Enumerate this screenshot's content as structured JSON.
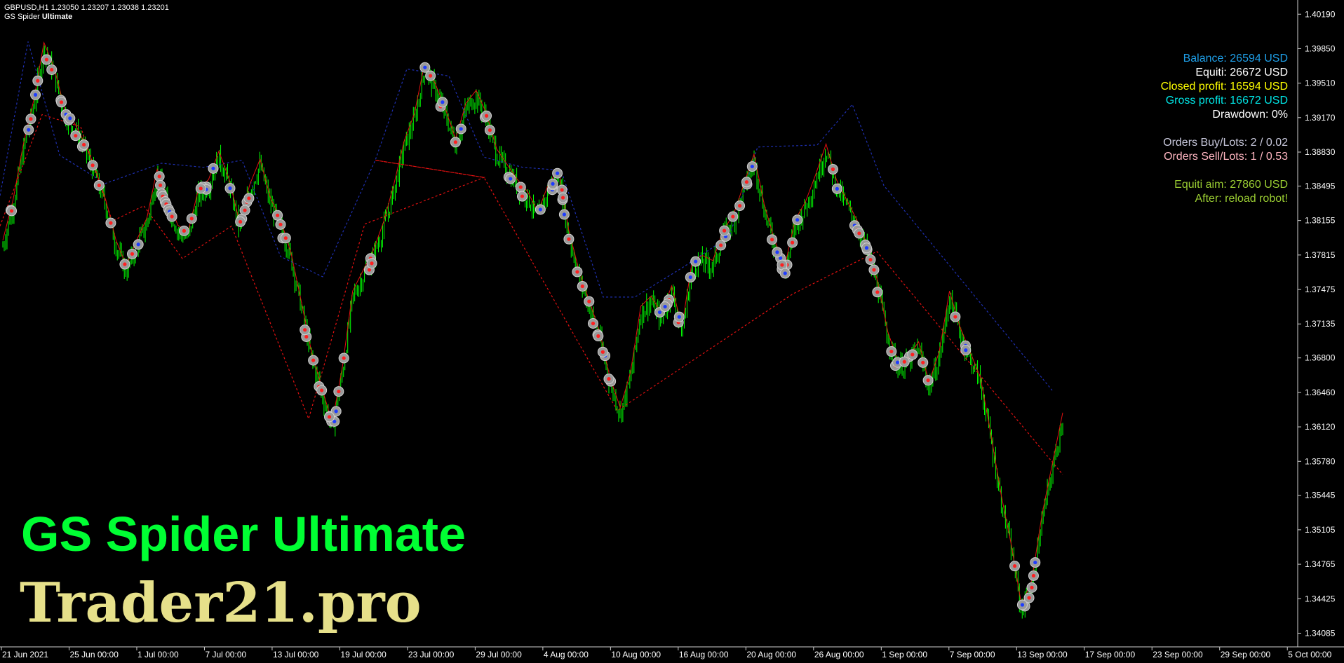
{
  "header": {
    "symbol_line": "GBPUSD,H1  1.23050 1.23207 1.23038 1.23201",
    "indicator_prefix": "GS Spider",
    "indicator_suffix": "Ultimate"
  },
  "info": {
    "balance": "Balance: 26594 USD",
    "equity": "Equiti: 26672 USD",
    "closed_profit": "Closed profit: 16594 USD",
    "gross_profit": "Gross profit: 16672 USD",
    "drawdown": "Drawdown: 0%",
    "orders_buy": "Orders Buy/Lots: 2 / 0.02",
    "orders_sell": "Orders Sell/Lots: 1 / 0.53",
    "equity_aim": "Equiti aim: 27860 USD",
    "after": "After: reload robot!"
  },
  "overlay": {
    "title": "GS Spider Ultimate",
    "site": "Trader21.pro"
  },
  "colors": {
    "background": "#000000",
    "candles": "#00ff00",
    "balance": "#1e9fe8",
    "equity": "#ffffff",
    "closed_profit": "#ffff00",
    "gross_profit": "#00e5e5",
    "orders_buy": "#c8c8dc",
    "orders_sell": "#ffb6c1",
    "equity_aim": "#9acd32",
    "title": "#00ff33",
    "site": "#e6e08a",
    "buy_line": "#1e2fb0",
    "sell_line": "#e01010"
  },
  "chart_data": {
    "type": "line",
    "symbol": "GBPUSD",
    "timeframe": "H1",
    "x_ticks": [
      "21 Jun 2021",
      "25 Jun 00:00",
      "1 Jul 00:00",
      "7 Jul 00:00",
      "13 Jul 00:00",
      "19 Jul 00:00",
      "23 Jul 00:00",
      "29 Jul 00:00",
      "4 Aug 00:00",
      "10 Aug 00:00",
      "16 Aug 00:00",
      "20 Aug 00:00",
      "26 Aug 00:00",
      "1 Sep 00:00",
      "7 Sep 00:00",
      "13 Sep 00:00",
      "17 Sep 00:00",
      "23 Sep 00:00",
      "29 Sep 00:00",
      "5 Oct 00:00"
    ],
    "y_ticks": [
      "1.40190",
      "1.39850",
      "1.39510",
      "1.39170",
      "1.38830",
      "1.38495",
      "1.38155",
      "1.37815",
      "1.37475",
      "1.37135",
      "1.36800",
      "1.36460",
      "1.36120",
      "1.35780",
      "1.35445",
      "1.35105",
      "1.34765",
      "1.34425",
      "1.34085"
    ],
    "ylim": [
      1.3395,
      1.4033
    ],
    "price_series": [
      1.379,
      1.383,
      1.3885,
      1.3928,
      1.3985,
      1.396,
      1.392,
      1.3905,
      1.3885,
      1.386,
      1.383,
      1.379,
      1.3765,
      1.379,
      1.3812,
      1.386,
      1.3832,
      1.3805,
      1.3798,
      1.384,
      1.385,
      1.3878,
      1.385,
      1.3808,
      1.3845,
      1.387,
      1.3832,
      1.381,
      1.3778,
      1.373,
      1.368,
      1.3645,
      1.361,
      1.3665,
      1.374,
      1.376,
      1.378,
      1.3808,
      1.3845,
      1.3888,
      1.3915,
      1.3965,
      1.3945,
      1.392,
      1.389,
      1.3925,
      1.3938,
      1.3915,
      1.388,
      1.3865,
      1.385,
      1.3838,
      1.3818,
      1.3845,
      1.386,
      1.38,
      1.376,
      1.373,
      1.37,
      1.3655,
      1.3625,
      1.366,
      1.3725,
      1.3735,
      1.3718,
      1.3745,
      1.3705,
      1.377,
      1.3775,
      1.377,
      1.38,
      1.3815,
      1.3845,
      1.3875,
      1.3825,
      1.379,
      1.3765,
      1.381,
      1.3828,
      1.3855,
      1.3885,
      1.385,
      1.383,
      1.381,
      1.3785,
      1.375,
      1.37,
      1.367,
      1.3675,
      1.369,
      1.365,
      1.368,
      1.374,
      1.3705,
      1.368,
      1.3655,
      1.36,
      1.354,
      1.349,
      1.343,
      1.3455,
      1.352,
      1.357,
      1.362
    ],
    "series": [
      {
        "name": "Buy",
        "type": "dotted",
        "points": [
          [
            0,
            1.384
          ],
          [
            40,
            1.3992
          ],
          [
            85,
            1.388
          ],
          [
            150,
            1.3852
          ],
          [
            230,
            1.3872
          ],
          [
            290,
            1.3868
          ],
          [
            345,
            1.3875
          ],
          [
            400,
            1.378
          ],
          [
            460,
            1.376
          ],
          [
            535,
            1.3875
          ],
          [
            580,
            1.3965
          ],
          [
            640,
            1.3958
          ],
          [
            690,
            1.3878
          ],
          [
            745,
            1.3868
          ],
          [
            800,
            1.3865
          ],
          [
            860,
            1.374
          ],
          [
            905,
            1.374
          ],
          [
            975,
            1.377
          ],
          [
            1040,
            1.38
          ],
          [
            1080,
            1.3888
          ],
          [
            1165,
            1.389
          ],
          [
            1215,
            1.393
          ],
          [
            1260,
            1.385
          ],
          [
            1500,
            1.3648
          ]
        ]
      },
      {
        "name": "Sell",
        "type": "dotted",
        "points": [
          [
            0,
            1.381
          ],
          [
            60,
            1.392
          ],
          [
            115,
            1.3908
          ],
          [
            160,
            1.3815
          ],
          [
            205,
            1.383
          ],
          [
            260,
            1.3778
          ],
          [
            330,
            1.381
          ],
          [
            440,
            1.362
          ],
          [
            520,
            1.3812
          ],
          [
            690,
            1.3858
          ],
          [
            535,
            1.3875
          ],
          [
            690,
            1.3858
          ],
          [
            880,
            1.3628
          ],
          [
            1130,
            1.3743
          ],
          [
            1250,
            1.3785
          ],
          [
            1515,
            1.3565
          ]
        ]
      }
    ]
  }
}
